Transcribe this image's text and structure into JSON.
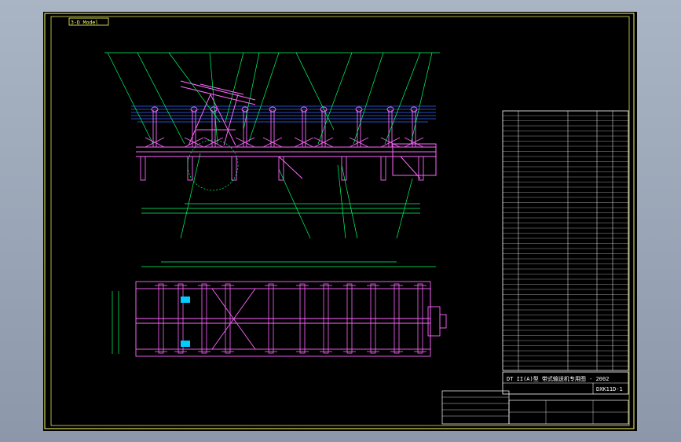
{
  "window": {
    "tab_label": "3-D Model"
  },
  "colors": {
    "background": "#000000",
    "frame": "#ffff66",
    "structure": "#ff66ff",
    "dimension": "#00ff66",
    "hidden": "#3366ff",
    "text": "#ffffff",
    "accent": "#00ccff"
  },
  "drawing": {
    "title_block": {
      "drawing_number": "DXK11D-1",
      "product_title": "DT II(A)型 带式输送机专用图 - 2002"
    }
  }
}
